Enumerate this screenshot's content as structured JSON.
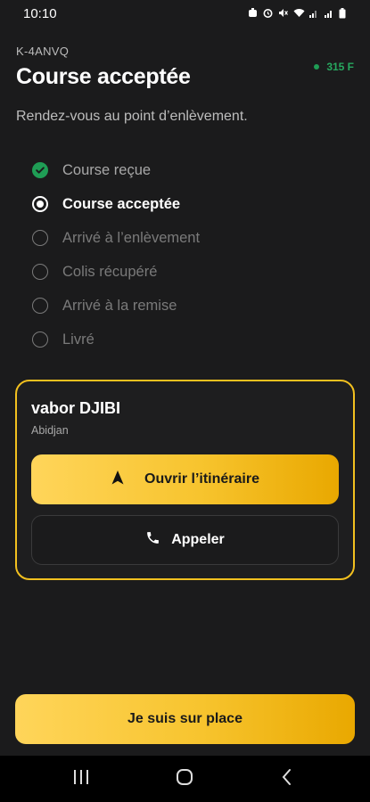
{
  "status_bar": {
    "time": "10:10",
    "icons": [
      "alarm-badge-icon",
      "alarm-clock-icon",
      "mute-icon",
      "wifi-icon",
      "signal-icon",
      "signal-icon-2",
      "battery-icon"
    ]
  },
  "header": {
    "order_code": "K-4ANVQ",
    "title": "Course acceptée",
    "price": "315 F",
    "subtitle": "Rendez-vous au point d’enlèvement."
  },
  "steps": [
    {
      "label": "Course reçue",
      "state": "done"
    },
    {
      "label": "Course acceptée",
      "state": "current"
    },
    {
      "label": "Arrivé à l’enlèvement",
      "state": "pending"
    },
    {
      "label": "Colis récupéré",
      "state": "pending"
    },
    {
      "label": "Arrivé à la remise",
      "state": "pending"
    },
    {
      "label": "Livré",
      "state": "pending"
    }
  ],
  "contact": {
    "name": "vabor DJIBI",
    "city": "Abidjan",
    "route_label": "Ouvrir l’itinéraire",
    "call_label": "Appeler"
  },
  "action": {
    "arrived_label": "Je suis sur place"
  },
  "colors": {
    "accent": "#f7c42e",
    "success": "#1f9d55",
    "background": "#1b1b1c"
  }
}
